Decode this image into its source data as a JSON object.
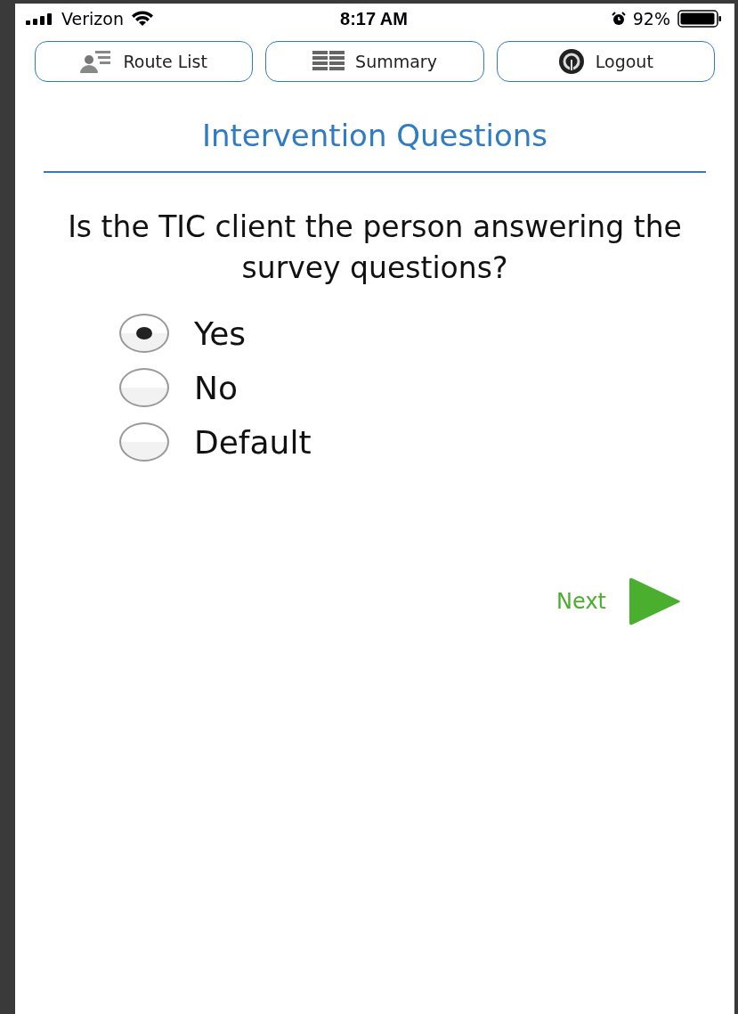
{
  "status_bar": {
    "carrier": "Verizon",
    "time": "8:17 AM",
    "battery": "92%"
  },
  "nav_buttons": [
    {
      "label": "Route List"
    },
    {
      "label": "Summary"
    },
    {
      "label": "Logout"
    }
  ],
  "title": "Intervention Questions",
  "question": "Is the TIC client the person answering the survey questions?",
  "options": [
    {
      "label": "Yes",
      "selected": true
    },
    {
      "label": "No",
      "selected": false
    },
    {
      "label": "Default",
      "selected": false
    }
  ],
  "next_button": {
    "label": "Next"
  }
}
